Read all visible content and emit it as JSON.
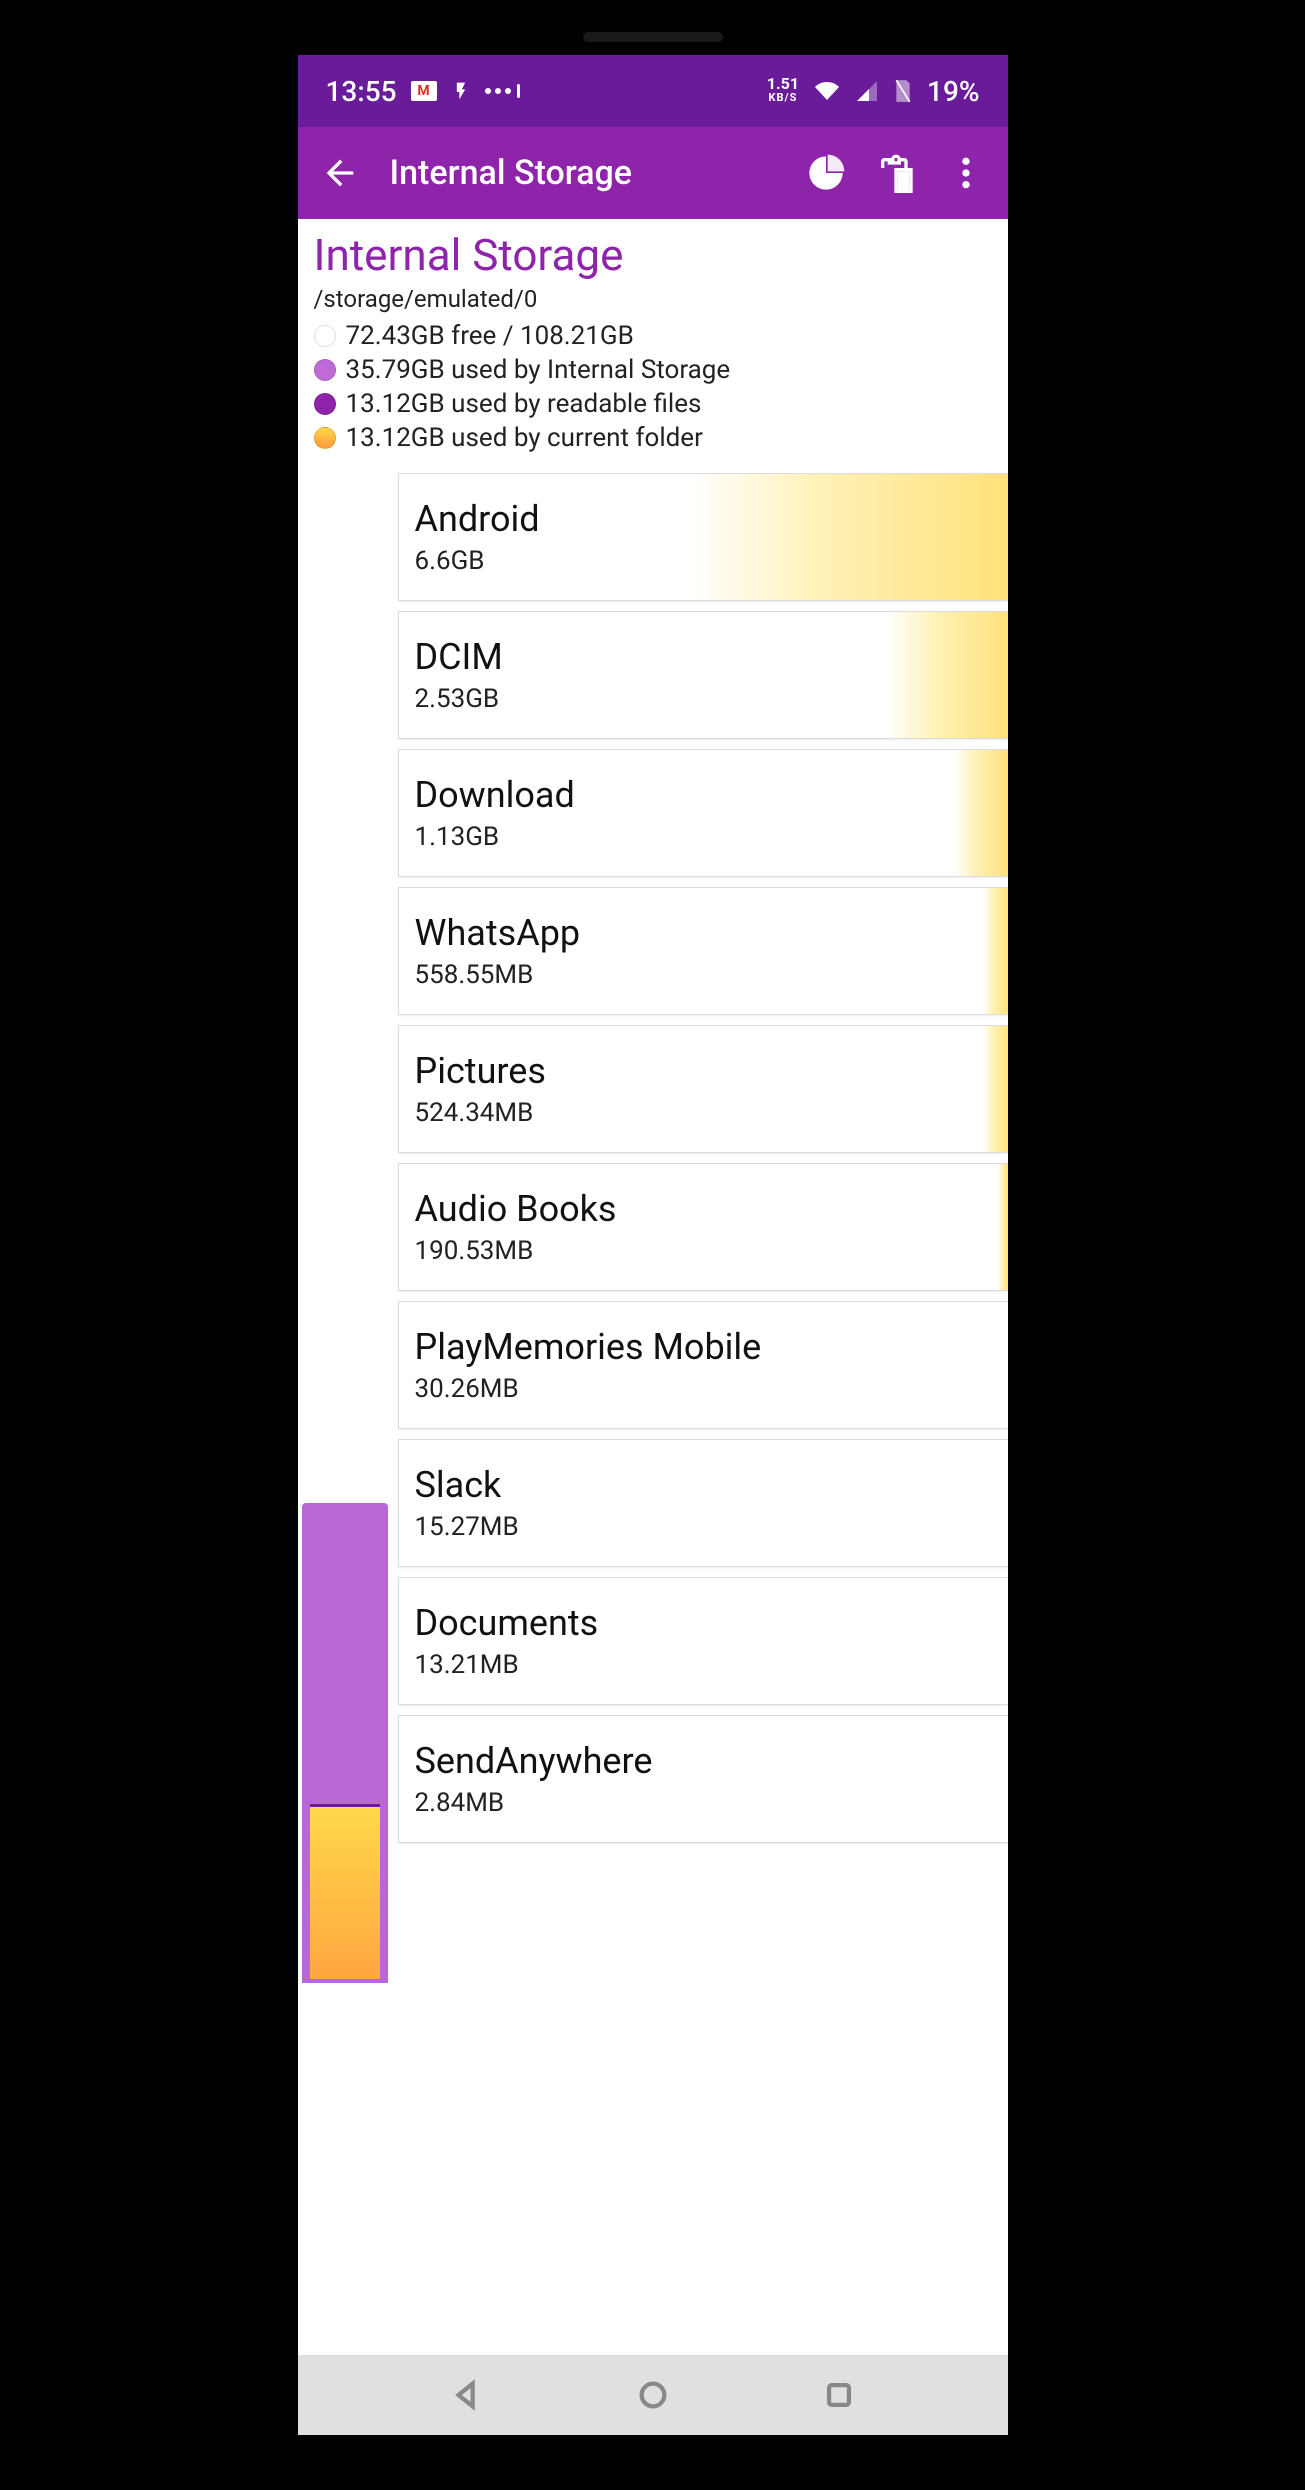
{
  "status": {
    "time": "13:55",
    "speed_value": "1.51",
    "speed_unit": "KB/S",
    "battery": "19%"
  },
  "appbar": {
    "title": "Internal Storage"
  },
  "header": {
    "title": "Internal Storage",
    "path": "/storage/emulated/0",
    "legend": [
      {
        "color": "#ffffff",
        "text": "72.43GB free / 108.21GB"
      },
      {
        "color": "#C06AD8",
        "text": "35.79GB used by Internal Storage"
      },
      {
        "color": "#8E24AA",
        "text": "13.12GB used by readable files"
      },
      {
        "color": "#FFB648",
        "text": "13.12GB used by current folder"
      }
    ]
  },
  "folders": [
    {
      "name": "Android",
      "size": "6.6GB",
      "fill": 52
    },
    {
      "name": "DCIM",
      "size": "2.53GB",
      "fill": 20
    },
    {
      "name": "Download",
      "size": "1.13GB",
      "fill": 9
    },
    {
      "name": "WhatsApp",
      "size": "558.55MB",
      "fill": 4
    },
    {
      "name": "Pictures",
      "size": "524.34MB",
      "fill": 4
    },
    {
      "name": "Audio Books",
      "size": "190.53MB",
      "fill": 1.5
    },
    {
      "name": "PlayMemories Mobile",
      "size": "30.26MB",
      "fill": 0
    },
    {
      "name": "Slack",
      "size": "15.27MB",
      "fill": 0
    },
    {
      "name": "Documents",
      "size": "13.21MB",
      "fill": 0
    },
    {
      "name": "SendAnywhere",
      "size": "2.84MB",
      "fill": 0
    }
  ]
}
